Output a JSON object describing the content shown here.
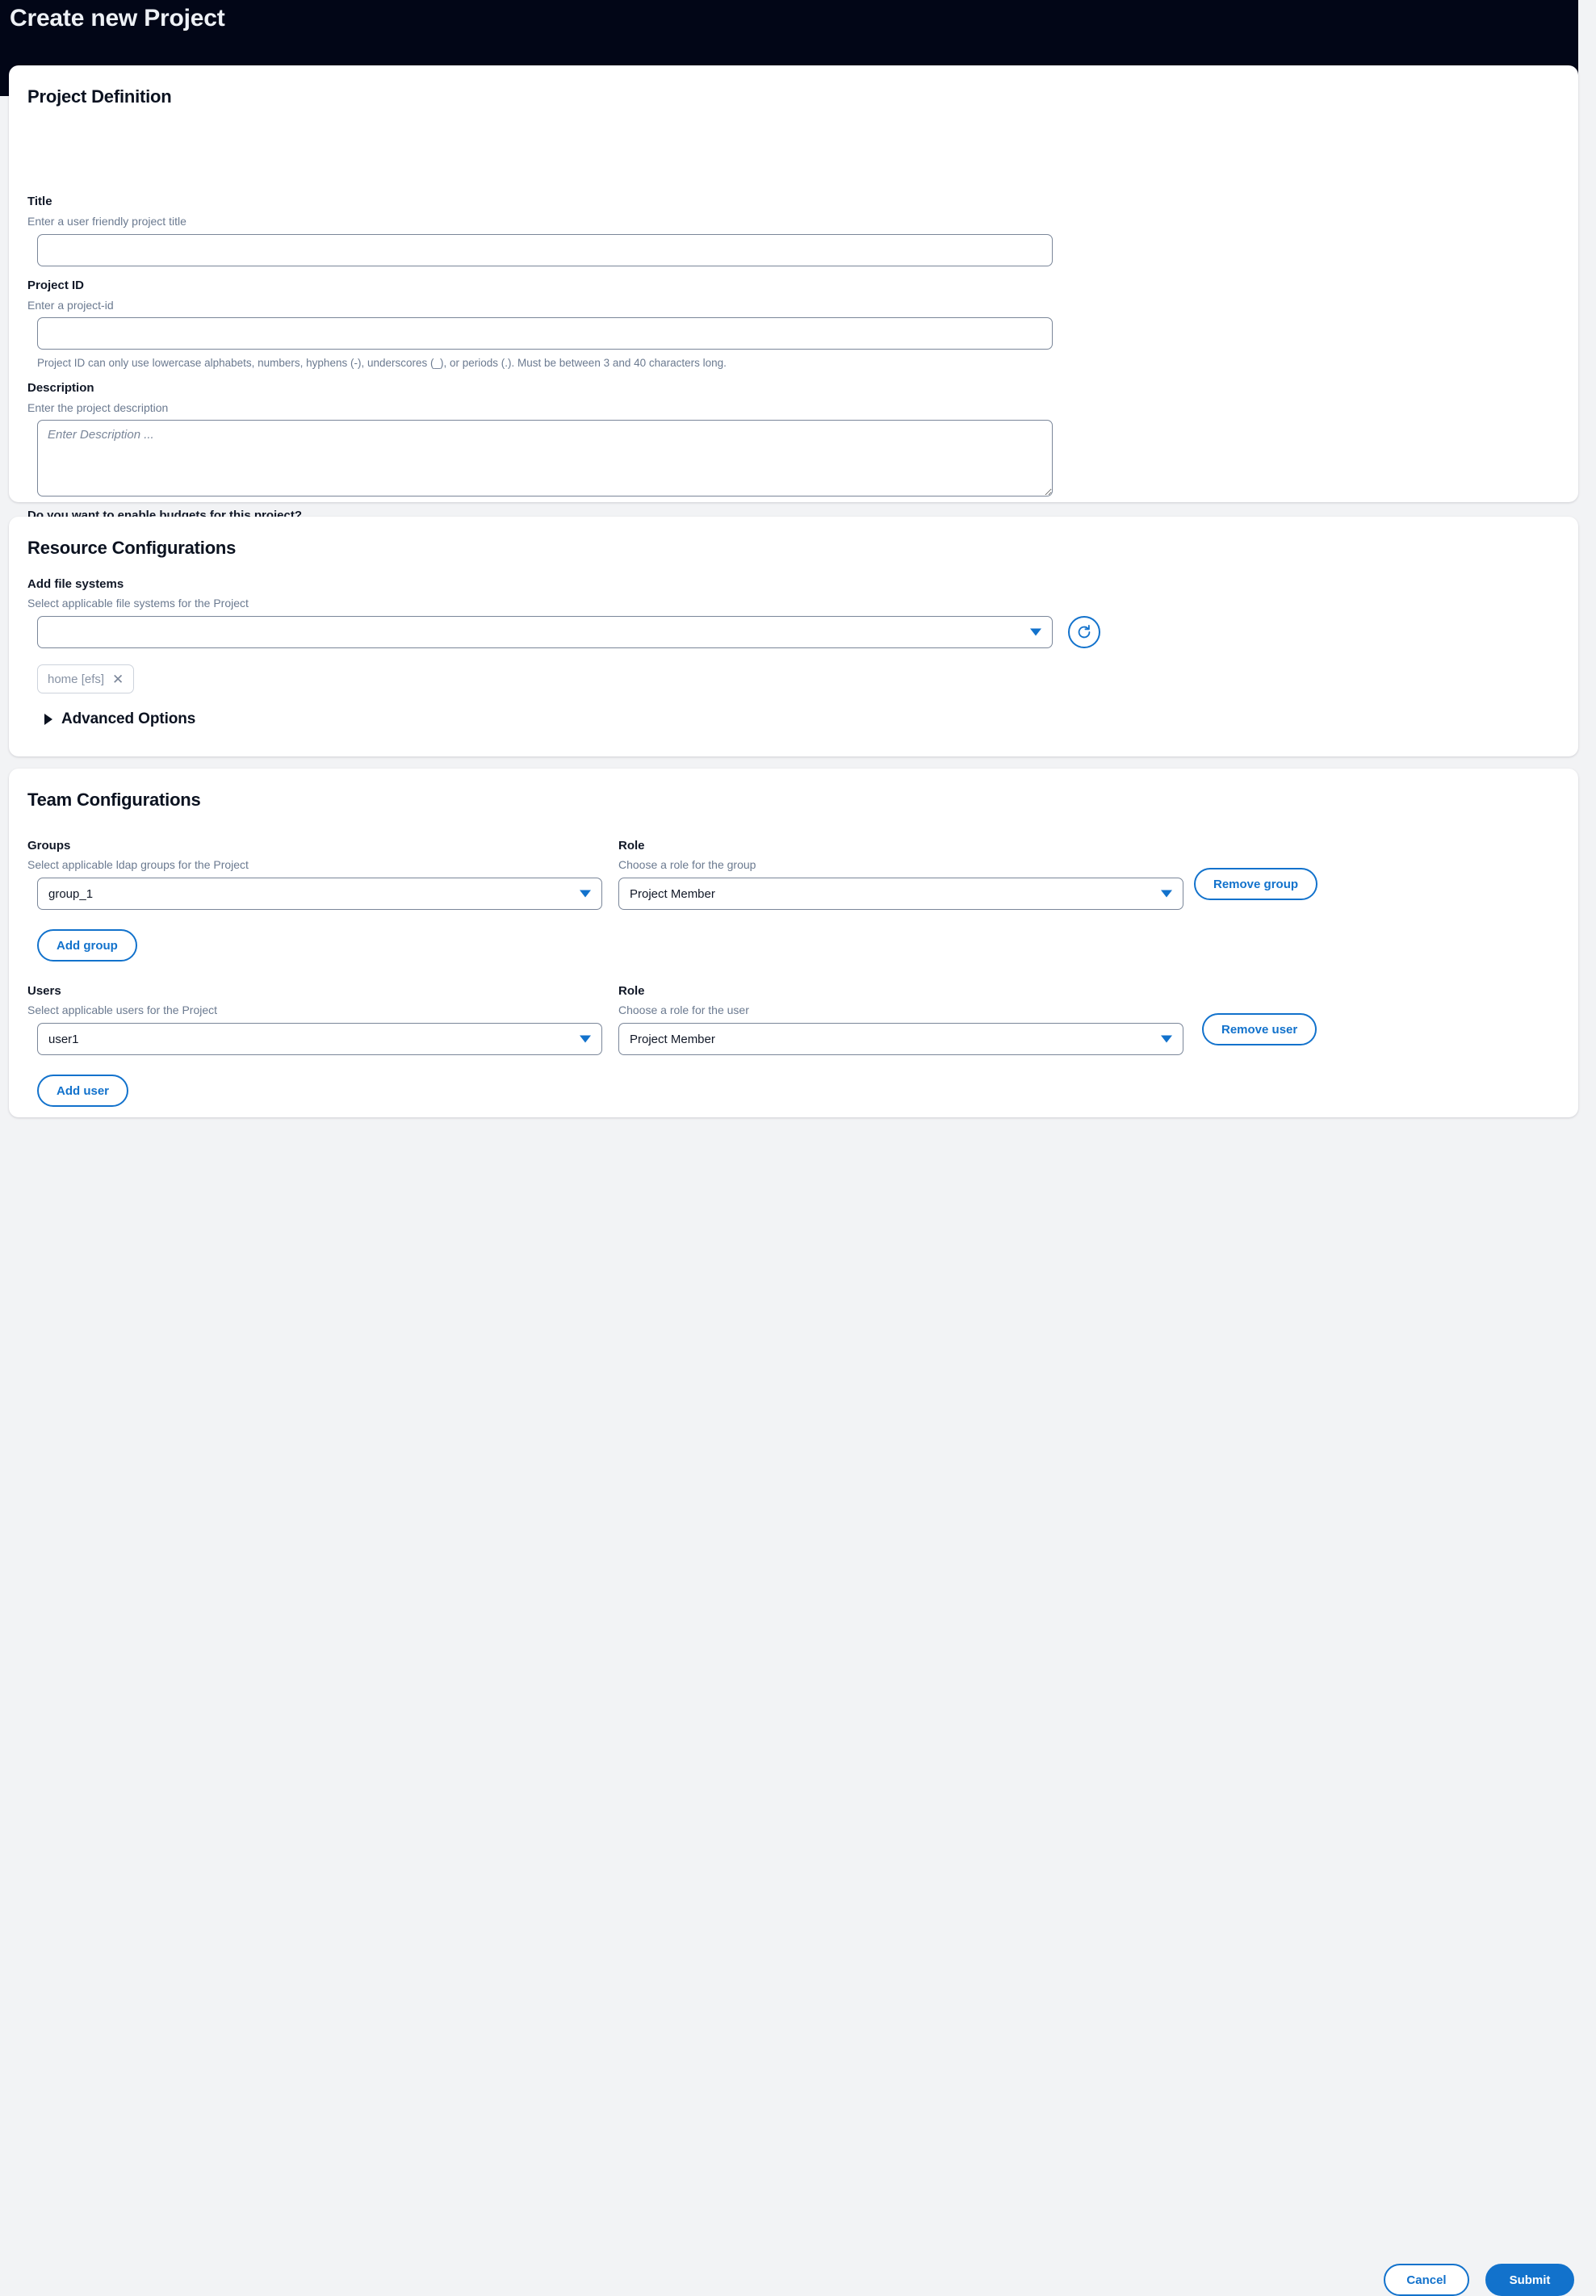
{
  "header": {
    "title": "Create new Project"
  },
  "project_definition": {
    "section_title": "Project Definition",
    "title_field": {
      "label": "Title",
      "hint": "Enter a user friendly project title",
      "value": "",
      "placeholder": ""
    },
    "project_id_field": {
      "label": "Project ID",
      "hint": "Enter a project-id",
      "value": "",
      "placeholder": "",
      "help": "Project ID can only use lowercase alphabets, numbers, hyphens (-), underscores (_), or periods (.). Must be between 3 and 40 characters long."
    },
    "description_field": {
      "label": "Description",
      "hint": "Enter the project description",
      "value": "",
      "placeholder": "Enter Description ..."
    },
    "budgets_question": "Do you want to enable budgets for this project?",
    "budgets_toggle_state": "off"
  },
  "resource_configurations": {
    "section_title": "Resource Configurations",
    "file_systems": {
      "label": "Add file systems",
      "hint": "Select applicable file systems for the Project",
      "selected_value": "",
      "dropdown_icon": "chevron-down-icon",
      "refresh_icon": "refresh-icon",
      "chips": [
        {
          "label": "home [efs]",
          "remove_icon": "close-icon"
        }
      ]
    },
    "advanced_options": {
      "label": "Advanced Options",
      "expand_icon": "triangle-right-icon",
      "expanded": false
    }
  },
  "team_configurations": {
    "section_title": "Team Configurations",
    "groups": {
      "label": "Groups",
      "hint": "Select applicable ldap groups for the Project",
      "value": "group_1",
      "role_label": "Role",
      "role_hint": "Choose a role for the group",
      "role_value": "Project Member",
      "remove_button": "Remove group",
      "add_button": "Add group"
    },
    "users": {
      "label": "Users",
      "hint": "Select applicable users for the Project",
      "value": "user1",
      "role_label": "Role",
      "role_hint": "Choose a role for the user",
      "role_value": "Project Member",
      "remove_button": "Remove user",
      "add_button": "Add user"
    }
  },
  "footer": {
    "cancel_label": "Cancel",
    "submit_label": "Submit"
  },
  "colors": {
    "header_bg": "#020617",
    "page_bg": "#f2f3f5",
    "accent_blue": "#1272cc",
    "text_dark": "#0b1220",
    "text_muted": "#6b7a90",
    "border_input": "#7a8699",
    "toggle_off": "#3f4b5e"
  }
}
